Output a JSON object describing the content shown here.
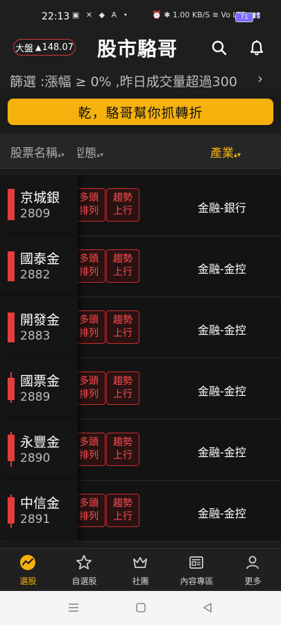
{
  "status_bar": {
    "time": "22:13",
    "left_icons": "▣ ✕ ◆ A •",
    "right_icons": "⏰ ✱ 1.00 KB/S ≋ Vo LTE ▮▮▮",
    "battery": "71"
  },
  "header": {
    "index_name": "大盤",
    "index_arrow": "▲",
    "index_value": "148.07",
    "title": "股市駱哥"
  },
  "filter": {
    "text": "篩選 :漲幅 ≥ 0% ,昨日成交量超過300",
    "chevron": "›"
  },
  "banner": {
    "text": "乾，駱哥幫你抓轉折"
  },
  "table": {
    "col_name": "股票名稱",
    "col_pattern": "K型態",
    "col_industry": "產業",
    "sort_icon": "▴▾",
    "rows": [
      {
        "name": "京城銀",
        "code": "2809",
        "tag1": "多頭排列",
        "tag2": "趨勢上行",
        "industry": "金融-銀行"
      },
      {
        "name": "國泰金",
        "code": "2882",
        "tag1": "多頭排列",
        "tag2": "趨勢上行",
        "industry": "金融-金控"
      },
      {
        "name": "開發金",
        "code": "2883",
        "tag1": "多頭排列",
        "tag2": "趨勢上行",
        "industry": "金融-金控"
      },
      {
        "name": "國票金",
        "code": "2889",
        "tag1": "多頭排列",
        "tag2": "趨勢上行",
        "industry": "金融-金控"
      },
      {
        "name": "永豐金",
        "code": "2890",
        "tag1": "多頭排列",
        "tag2": "趨勢上行",
        "industry": "金融-金控"
      },
      {
        "name": "中信金",
        "code": "2891",
        "tag1": "多頭排列",
        "tag2": "趨勢上行",
        "industry": "金融-金控"
      }
    ]
  },
  "tabs": [
    {
      "label": "選股",
      "icon": "trend-circle-icon",
      "active": true
    },
    {
      "label": "自選股",
      "icon": "star-icon",
      "active": false
    },
    {
      "label": "社團",
      "icon": "crown-icon",
      "active": false
    },
    {
      "label": "內容專區",
      "icon": "newspaper-icon",
      "active": false
    },
    {
      "label": "更多",
      "icon": "person-icon",
      "active": false
    }
  ],
  "colors": {
    "accent": "#f5b20c",
    "up_red": "#e53c3c",
    "background": "#1b1b1b"
  }
}
